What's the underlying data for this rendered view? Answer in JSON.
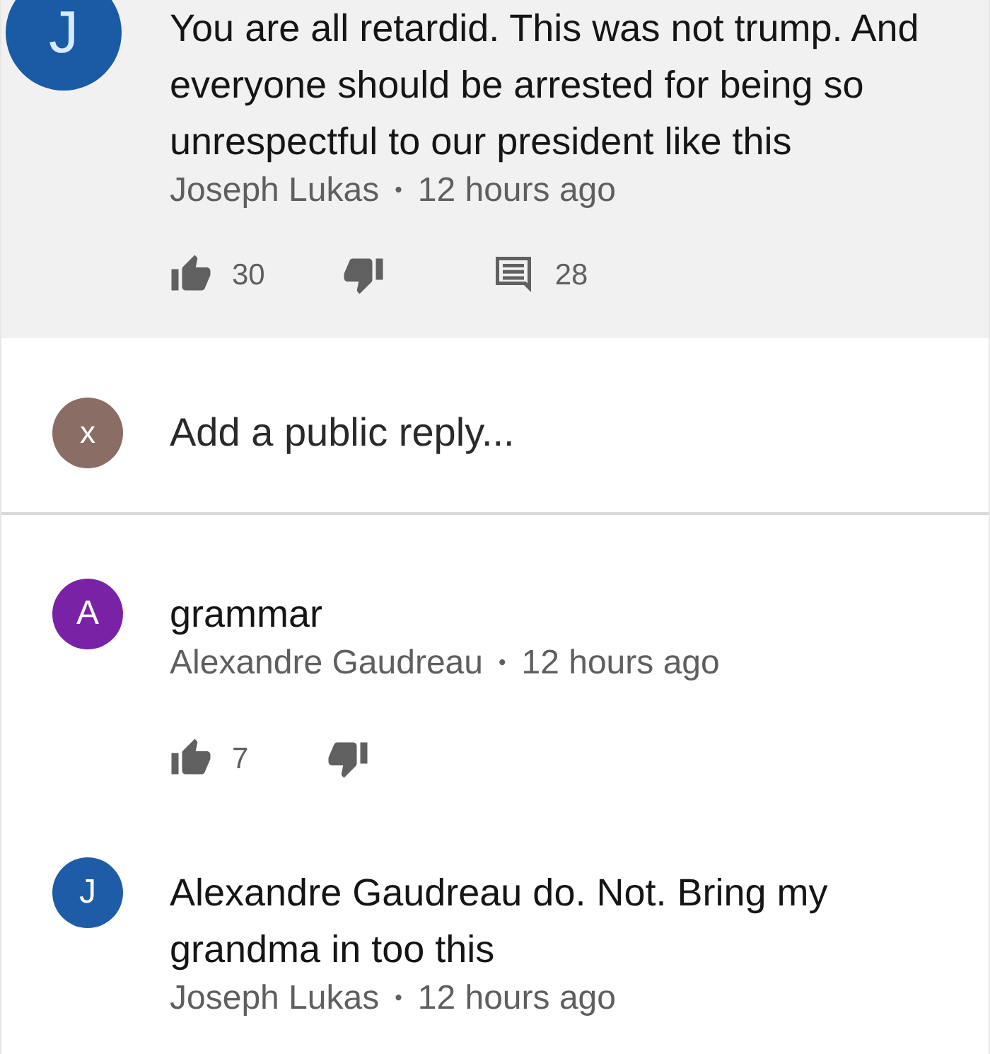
{
  "items": [
    {
      "kind": "comment",
      "highlighted": true,
      "avatar_letter": "J",
      "color": "#1b5aa5",
      "text": "You are all retardid. This was not trump. And everyone should be arrested for being so unrespectful to our president like this",
      "author": "Joseph Lukas",
      "separator": "•",
      "time": "12 hours ago",
      "actions": {
        "likes": "30",
        "replies": "28"
      }
    },
    {
      "kind": "reply_box",
      "avatar_letter": "x",
      "color": "#8a6d65",
      "placeholder": "Add a public reply..."
    },
    {
      "kind": "reply",
      "highlighted": false,
      "avatar_letter": "A",
      "color": "#7a22a5",
      "text": "grammar",
      "author": "Alexandre Gaudreau",
      "separator": "•",
      "time": "12 hours ago",
      "actions": {
        "likes": "7"
      }
    },
    {
      "kind": "reply",
      "highlighted": false,
      "avatar_letter": "J",
      "color": "#1f5ca8",
      "text": "Alexandre Gaudreau do. Not. Bring my grandma in too this",
      "author": "Joseph Lukas",
      "separator": "•",
      "time": "12 hours ago"
    }
  ]
}
